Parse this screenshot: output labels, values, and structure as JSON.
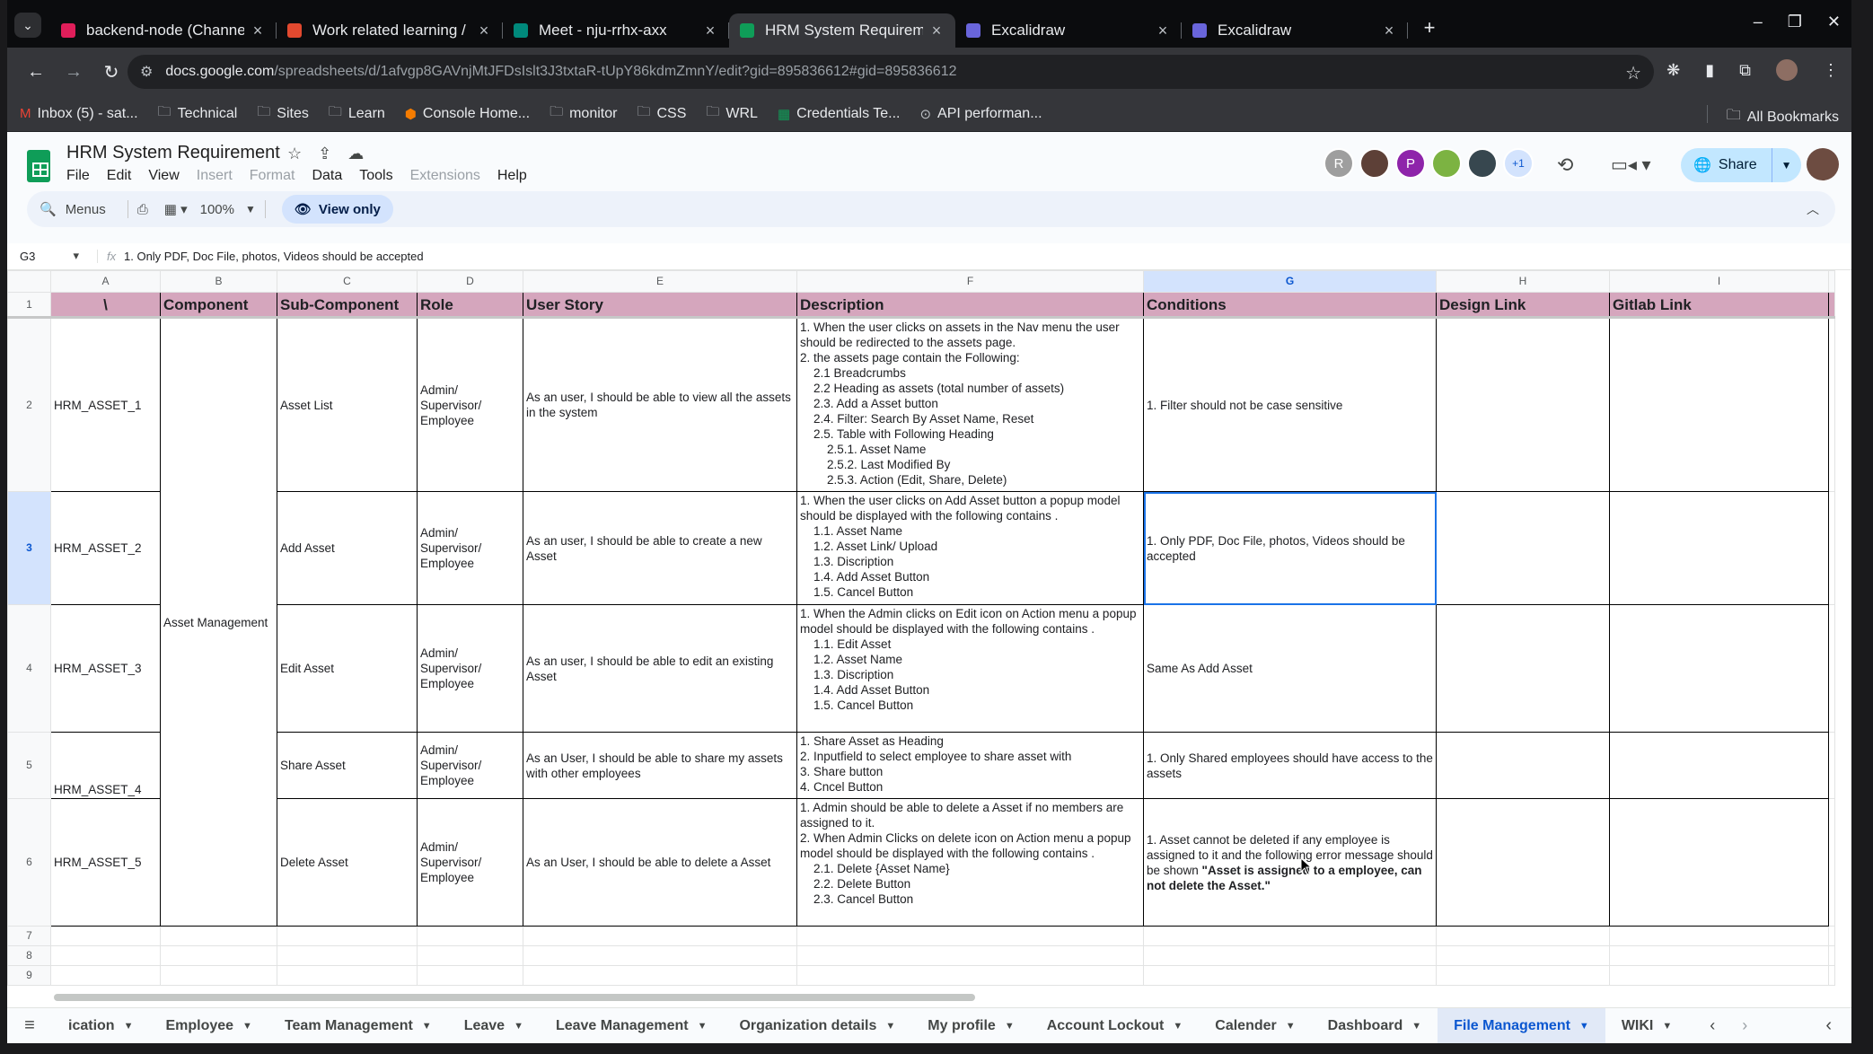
{
  "browser": {
    "tabs": [
      {
        "title": "backend-node (Channel",
        "color": "#e01e5a",
        "active": false
      },
      {
        "title": "Work related learning /",
        "color": "#e2492f",
        "active": false
      },
      {
        "title": "Meet - nju-rrhx-axx",
        "color": "#00897b",
        "active": false
      },
      {
        "title": "HRM System Requireme",
        "color": "#0f9d58",
        "active": true
      },
      {
        "title": "Excalidraw",
        "color": "#6965db",
        "active": false
      },
      {
        "title": "Excalidraw",
        "color": "#6965db",
        "active": false
      }
    ],
    "url_host": "docs.google.com",
    "url_path": "/spreadsheets/d/1afvgp8GAVnjMtJFDsIslt3J3txtaR-tUpY86kdmZmnY/edit?gid=895836612#gid=895836612",
    "bookmarks": [
      {
        "label": "Inbox (5) - sat...",
        "icon": "gmail-icon"
      },
      {
        "label": "Technical",
        "icon": "folder-icon"
      },
      {
        "label": "Sites",
        "icon": "folder-icon"
      },
      {
        "label": "Learn",
        "icon": "folder-icon"
      },
      {
        "label": "Console Home...",
        "icon": "aws-icon"
      },
      {
        "label": "monitor",
        "icon": "folder-icon"
      },
      {
        "label": "CSS",
        "icon": "folder-icon"
      },
      {
        "label": "WRL",
        "icon": "folder-icon"
      },
      {
        "label": "Credentials Te...",
        "icon": "sheets-icon"
      },
      {
        "label": "API performan...",
        "icon": "api-icon"
      }
    ],
    "all_bookmarks": "All Bookmarks"
  },
  "doc": {
    "title": "HRM System Requirement",
    "menus": [
      {
        "label": "File",
        "enabled": true
      },
      {
        "label": "Edit",
        "enabled": true
      },
      {
        "label": "View",
        "enabled": true
      },
      {
        "label": "Insert",
        "enabled": false
      },
      {
        "label": "Format",
        "enabled": false
      },
      {
        "label": "Data",
        "enabled": true
      },
      {
        "label": "Tools",
        "enabled": true
      },
      {
        "label": "Extensions",
        "enabled": false
      },
      {
        "label": "Help",
        "enabled": true
      }
    ],
    "avatars": [
      {
        "label": "R",
        "color": "#9e9e9e"
      },
      {
        "label": "",
        "color": "#5d4037"
      },
      {
        "label": "P",
        "color": "#8e24aa"
      },
      {
        "label": "",
        "color": "#7cb342"
      },
      {
        "label": "",
        "color": "#37474f"
      }
    ],
    "avatars_more": "+1",
    "share_label": "Share",
    "toolbar": {
      "menus_label": "Menus",
      "zoom": "100%",
      "view_only": "View only"
    },
    "formula": {
      "cell": "G3",
      "content": "1. Only PDF, Doc File, photos, Videos should be accepted"
    }
  },
  "sheet": {
    "columns": [
      "A",
      "B",
      "C",
      "D",
      "E",
      "F",
      "G",
      "H",
      "I"
    ],
    "selected_column": "G",
    "selected_row": "3",
    "header": [
      "\\",
      "Component",
      "Sub-Component",
      "Role",
      "User Story",
      "Description",
      "Conditions",
      "Design Link",
      "Gitlab Link"
    ],
    "component_merged": "Asset Management",
    "rows": [
      {
        "num": "2",
        "id": "HRM_ASSET_1",
        "sub": "Asset List",
        "role": "Admin/\nSupervisor/\nEmployee",
        "story": "As an user, I should be able to view all the assets in the system",
        "desc": "1. When the user clicks on assets in the Nav menu the user should be redirected to the assets page.\n2. the assets page contain the Following:\n    2.1 Breadcrumbs\n    2.2 Heading as assets (total number of assets)\n    2.3. Add a Asset button\n    2.4. Filter: Search By Asset Name, Reset\n    2.5. Table with Following Heading\n        2.5.1. Asset Name\n        2.5.2. Last Modified By\n        2.5.3. Action (Edit, Share, Delete)",
        "cond": "1. Filter should not be case sensitive"
      },
      {
        "num": "3",
        "id": "HRM_ASSET_2",
        "sub": "Add Asset",
        "role": "Admin/\nSupervisor/\nEmployee",
        "story": "As an user, I should be able to create a new Asset",
        "desc": "1. When the user clicks on Add Asset button a popup model should be displayed with the following contains .\n    1.1. Asset Name\n    1.2. Asset Link/ Upload\n    1.3. Discription\n    1.4. Add Asset Button\n    1.5. Cancel Button",
        "cond": "1. Only PDF, Doc File, photos, Videos should be accepted"
      },
      {
        "num": "4",
        "id": "HRM_ASSET_3",
        "sub": "Edit Asset",
        "role": "Admin/\nSupervisor/\nEmployee",
        "story": "As an user, I should be able to edit an existing Asset",
        "desc": "1. When the Admin clicks on Edit icon on Action menu a popup model should be displayed with the following contains .\n    1.1. Edit Asset\n    1.2. Asset Name\n    1.3. Discription\n    1.4. Add Asset Button\n    1.5. Cancel Button",
        "cond": "Same As Add Asset"
      },
      {
        "num": "5",
        "id": "HRM_ASSET_4",
        "sub": "Share Asset",
        "role": "Admin/\nSupervisor/\nEmployee",
        "story": "As an User, I should be able to share my assets with other employees",
        "desc": "1. Share Asset as Heading\n2. Inputfield to select employee to share asset with\n3. Share button\n4. Cncel Button",
        "cond": "1. Only Shared employees should have access to the assets"
      },
      {
        "num": "6",
        "id": "HRM_ASSET_5",
        "sub": "Delete Asset",
        "role": "Admin/\nSupervisor/\nEmployee",
        "story": "As an User, I should be able to delete a Asset",
        "desc": "1. Admin should be able to delete a Asset if no members are assigned to it.\n2. When Admin Clicks on delete icon on Action menu a popup model should be displayed with the following contains .\n    2.1. Delete {Asset Name}\n    2.2. Delete Button\n    2.3. Cancel Button",
        "cond_prefix": "1. Asset cannot be deleted if any employee is assigned to it and the following error message should be shown ",
        "cond_bold": "\"Asset is assigned to a employee, can not delete the Asset.\""
      }
    ],
    "empty_rows": [
      "7",
      "8",
      "9"
    ]
  },
  "sheet_tabs": [
    {
      "label": "ication",
      "active": false
    },
    {
      "label": "Employee",
      "active": false
    },
    {
      "label": "Team Management",
      "active": false
    },
    {
      "label": "Leave",
      "active": false
    },
    {
      "label": "Leave Management",
      "active": false
    },
    {
      "label": "Organization details",
      "active": false
    },
    {
      "label": "My profile",
      "active": false
    },
    {
      "label": "Account Lockout",
      "active": false
    },
    {
      "label": "Calender",
      "active": false
    },
    {
      "label": "Dashboard",
      "active": false
    },
    {
      "label": "File Management",
      "active": true
    },
    {
      "label": "WIKI",
      "active": false
    }
  ]
}
